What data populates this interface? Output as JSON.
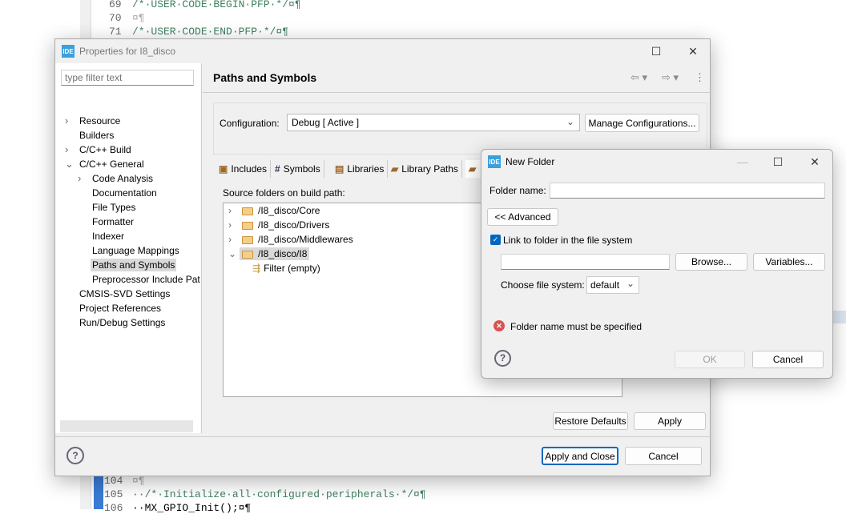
{
  "editor": {
    "lines": [
      {
        "num": "69",
        "text": "/*·USER·CODE·BEGIN·PFP·*/¤¶"
      },
      {
        "num": "70",
        "text": "¤¶"
      },
      {
        "num": "71",
        "text": "/*·USER·CODE·END·PFP·*/¤¶"
      },
      {
        "num": "104",
        "text": "¤¶"
      },
      {
        "num": "105",
        "text": "··/*·Initialize·all·configured·peripherals·*/¤¶"
      },
      {
        "num": "106",
        "text": "··MX_GPIO_Init();¤¶"
      }
    ]
  },
  "properties": {
    "title": "Properties for I8_disco",
    "filter_placeholder": "type filter text",
    "tree": [
      {
        "label": "Resource",
        "expand": ">"
      },
      {
        "label": "Builders",
        "expand": ""
      },
      {
        "label": "C/C++ Build",
        "expand": ">"
      },
      {
        "label": "C/C++ General",
        "expand": "v"
      },
      {
        "label": "Code Analysis",
        "expand": ">"
      },
      {
        "label": "Documentation",
        "expand": ""
      },
      {
        "label": "File Types",
        "expand": ""
      },
      {
        "label": "Formatter",
        "expand": ""
      },
      {
        "label": "Indexer",
        "expand": ""
      },
      {
        "label": "Language Mappings",
        "expand": ""
      },
      {
        "label": "Paths and Symbols",
        "expand": "",
        "selected": true
      },
      {
        "label": "Preprocessor Include Pat",
        "expand": ""
      },
      {
        "label": "CMSIS-SVD Settings",
        "expand": ""
      },
      {
        "label": "Project References",
        "expand": ""
      },
      {
        "label": "Run/Debug Settings",
        "expand": ""
      }
    ],
    "page_title": "Paths and Symbols",
    "configuration_label": "Configuration:",
    "configuration_value": "Debug  [ Active ]",
    "manage_configurations": "Manage Configurations...",
    "tabs": [
      "Includes",
      "Symbols",
      "Libraries",
      "Library Paths"
    ],
    "source_folders_label": "Source folders on build path:",
    "source_folders": [
      {
        "label": "/I8_disco/Core",
        "expanded": false
      },
      {
        "label": "/I8_disco/Drivers",
        "expanded": false
      },
      {
        "label": "/I8_disco/Middlewares",
        "expanded": false
      },
      {
        "label": "/I8_disco/I8",
        "expanded": true,
        "selected": true
      }
    ],
    "filter_child": "Filter (empty)",
    "restore_defaults": "Restore Defaults",
    "apply": "Apply",
    "apply_and_close": "Apply and Close",
    "cancel": "Cancel"
  },
  "new_folder": {
    "title": "New Folder",
    "folder_name_label": "Folder name:",
    "folder_name_value": "",
    "advanced": "<< Advanced",
    "link_checkbox": "Link to folder in the file system",
    "link_checked": true,
    "link_path_value": "",
    "browse": "Browse...",
    "variables": "Variables...",
    "choose_fs_label": "Choose file system:",
    "choose_fs_value": "default",
    "error": "Folder name must be specified",
    "ok": "OK",
    "cancel": "Cancel"
  }
}
